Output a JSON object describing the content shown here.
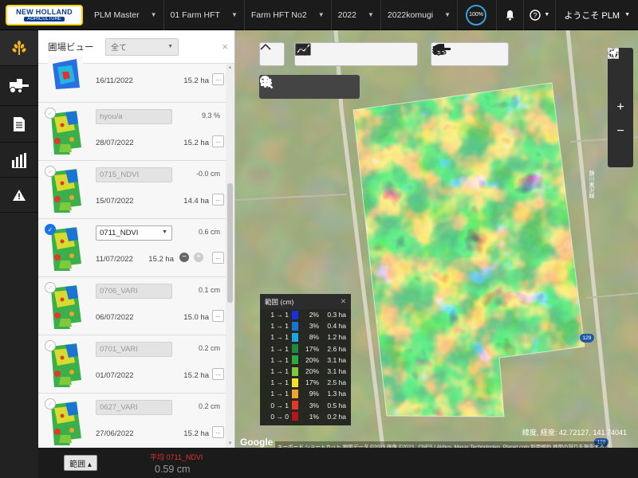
{
  "header": {
    "logo_line1": "NEW HOLLAND",
    "logo_line2": "AGRICULTURE",
    "breadcrumbs": [
      "PLM Master",
      "01 Farm HFT",
      "Farm HFT No2",
      "2022",
      "2022komugi"
    ],
    "progress_label": "100%",
    "user_label": "ようこそ PLM"
  },
  "sidebar": {
    "items": [
      {
        "icon": "wheat-icon",
        "label": ""
      },
      {
        "icon": "harvester-icon",
        "label": ""
      },
      {
        "icon": "document-icon",
        "label": ""
      },
      {
        "icon": "bar-chart-icon",
        "label": ""
      },
      {
        "icon": "warning-icon",
        "label": ""
      }
    ]
  },
  "panel": {
    "title": "圃場ビュー",
    "filter_value": "全て",
    "rows": [
      {
        "layer": "",
        "value": "",
        "date": "16/11/2022",
        "ha": "15.2 ha",
        "checked": false,
        "selected": false
      },
      {
        "layer": "hyou/a",
        "value": "9.3 %",
        "date": "28/07/2022",
        "ha": "15.2 ha",
        "checked": false,
        "selected": false
      },
      {
        "layer": "0715_NDVI",
        "value": "-0.0 cm",
        "date": "15/07/2022",
        "ha": "14.4 ha",
        "checked": false,
        "selected": false
      },
      {
        "layer": "0711_NDVI",
        "value": "0.6 cm",
        "date": "11/07/2022",
        "ha": "15.2 ha",
        "checked": true,
        "selected": true
      },
      {
        "layer": "0706_VARI",
        "value": "0.1 cm",
        "date": "06/07/2022",
        "ha": "15.0 ha",
        "checked": false,
        "selected": false
      },
      {
        "layer": "0701_VARI",
        "value": "0.2 cm",
        "date": "01/07/2022",
        "ha": "15.2 ha",
        "checked": false,
        "selected": false
      },
      {
        "layer": "0627_VARI",
        "value": "0.2 cm",
        "date": "27/06/2022",
        "ha": "15.2 ha",
        "checked": false,
        "selected": false
      }
    ],
    "row_button": "...",
    "range_button": "範囲 ▴",
    "avg_label": "平均 0711_NDVI",
    "avg_value": "0.59 cm"
  },
  "legend": {
    "title": "範囲 (cm)",
    "rows": [
      {
        "range": "1 → 1",
        "color": "#1c2fd6",
        "pct": "2%",
        "ha": "0.3 ha"
      },
      {
        "range": "1 → 1",
        "color": "#1a74d4",
        "pct": "3%",
        "ha": "0.4 ha"
      },
      {
        "range": "1 → 1",
        "color": "#19a8e0",
        "pct": "8%",
        "ha": "1.2 ha"
      },
      {
        "range": "1 → 1",
        "color": "#1d8a3c",
        "pct": "17%",
        "ha": "2.6 ha"
      },
      {
        "range": "1 → 1",
        "color": "#2ea843",
        "pct": "20%",
        "ha": "3.1 ha"
      },
      {
        "range": "1 → 1",
        "color": "#7fca3c",
        "pct": "20%",
        "ha": "3.1 ha"
      },
      {
        "range": "1 → 1",
        "color": "#f3e22a",
        "pct": "17%",
        "ha": "2.5 ha"
      },
      {
        "range": "1 → 1",
        "color": "#f0a52a",
        "pct": "9%",
        "ha": "1.3 ha"
      },
      {
        "range": "0 → 1",
        "color": "#e0392b",
        "pct": "3%",
        "ha": "0.5 ha"
      },
      {
        "range": "0 → 0",
        "color": "#b8151b",
        "pct": "1%",
        "ha": "0.2 ha"
      }
    ]
  },
  "map": {
    "coords": "緯度, 経度: 42.72127, 141.74041",
    "google": "Google",
    "attribution": "キーボード ショートカット  地図データ ©2023 画像 ©2023 , CNES / Airbus, Maxar Technologies, Planet.com  利用規約  地図の誤りを報告する",
    "road_numbers": [
      "129",
      "129"
    ],
    "road_name": "静川東沢線"
  }
}
